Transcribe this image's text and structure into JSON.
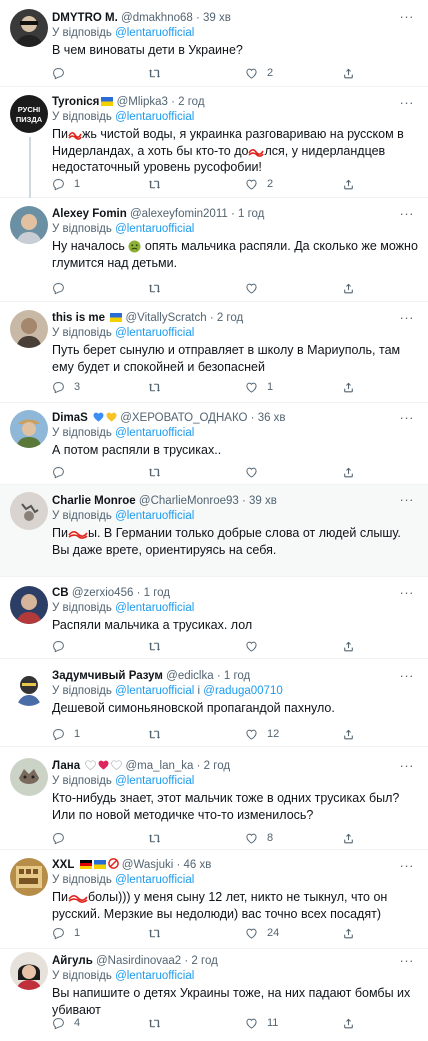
{
  "reply_prefix": "У відповідь",
  "reply_target": "@lentaruofficial",
  "tweets": [
    {
      "name": "DMYTRO M.",
      "handle": "@dmakhno68",
      "time": "· 39 хв",
      "text": "В чем виноваты дети в Украине?",
      "replies": "",
      "retweets": "",
      "likes": "2",
      "more": "···"
    },
    {
      "name": "Tyronicя",
      "handle": "@Mlipka3",
      "time": "· 2 год",
      "text_a": "Пи",
      "text_b": "жь чистой воды, я украинка разговариваю на русском в Нидерландах, а хоть бы кто-то до",
      "text_c": "лся, у нидерландцев недостаточный уровень русофобии!",
      "replies": "1",
      "retweets": "",
      "likes": "2",
      "more": "···",
      "avatar_text_1": "РУСНІ",
      "avatar_text_2": "ПИЗДА"
    },
    {
      "name": "Alexey Fomin",
      "handle": "@alexeyfomin2011",
      "time": "· 1 год",
      "text_a": "Ну началось",
      "text_b": "опять мальчика распяли. Да сколько же можно глумится над детьми.",
      "replies": "",
      "retweets": "",
      "likes": "",
      "more": "···"
    },
    {
      "name": "this is me",
      "handle": "@VitallyScratch",
      "time": "· 2 год",
      "text": "Путь берет сынулю и отправляет в школу в Мариуполь, там ему будет и спокойней и безопасней",
      "replies": "3",
      "retweets": "",
      "likes": "1",
      "more": "···"
    },
    {
      "name": "DimaS",
      "handle": "@ХЕРОВАТО_ОДНАКО",
      "time": "· 36 хв",
      "text": "А потом распяли в трусиках..",
      "replies": "",
      "retweets": "",
      "likes": "",
      "more": "···"
    },
    {
      "name": "Charlie Monroe",
      "handle": "@CharlieMonroe93",
      "time": "· 39 хв",
      "text_a": "Пи",
      "text_b": "ы. В Германии только добрые слова от людей слышу. Вы даже врете, ориентируясь на себя.",
      "more": "···"
    },
    {
      "name": "CB",
      "handle": "@zerxio456",
      "time": "· 1 год",
      "text": "Распяли мальчика а трусиках. лол",
      "replies": "",
      "retweets": "",
      "likes": "",
      "more": "···"
    },
    {
      "name": "Задумчивый Разум",
      "handle": "@ediclka",
      "time": "· 1 год",
      "reply_and": "і",
      "reply_second": "@raduga00710",
      "text": "Дешевой симоньяновской пропагандой пахнуло.",
      "replies": "1",
      "retweets": "",
      "likes": "12",
      "more": "···"
    },
    {
      "name": "Лана",
      "handle": "@ma_lan_ka",
      "time": "· 2 год",
      "text": "Кто-нибудь знает, этот мальчик тоже в одних трусиках был? Или по новой методичке что-то изменилось?",
      "replies": "",
      "retweets": "",
      "likes": "8",
      "more": "···"
    },
    {
      "name": "XXL",
      "handle": "@Wasjuki",
      "time": "· 46 хв",
      "text_a": "Пи",
      "text_b": "болы))) у меня сыну 12 лет, никто не тыкнул, что он русский. Мерзкие вы недолюди) вас точно всех посадят)",
      "replies": "1",
      "retweets": "",
      "likes": "24",
      "more": "···"
    },
    {
      "name": "Айгуль",
      "handle": "@Nasirdinovaa2",
      "time": "· 2 год",
      "text": "Вы напишите о детях Украины тоже, на них падают бомбы их убивают",
      "replies": "4",
      "retweets": "",
      "likes": "11",
      "more": "···"
    }
  ],
  "colors": {
    "link": "#1d9bf0",
    "muted": "#536471",
    "text": "#0f1419",
    "scribble": "#e0241b"
  },
  "icons": [
    "reply-icon",
    "retweet-icon",
    "like-icon",
    "share-icon",
    "more-icon"
  ]
}
